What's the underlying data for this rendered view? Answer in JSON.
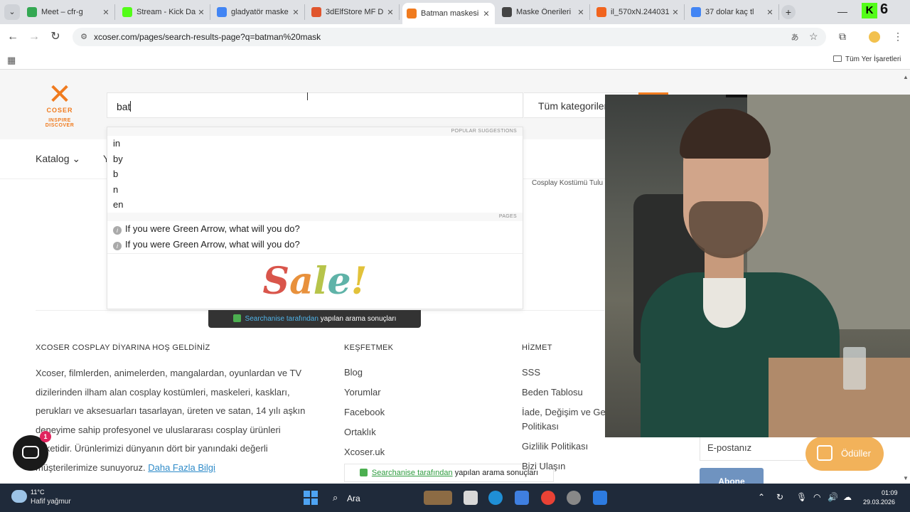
{
  "tabs": [
    {
      "title": "Meet – cfr-g",
      "favicon": "google-meet-icon",
      "color": "#34a853",
      "active": false
    },
    {
      "title": "Stream - Kick Da",
      "favicon": "kick-icon",
      "color": "#53fc18",
      "active": false
    },
    {
      "title": "gladyatör maske",
      "favicon": "google-icon",
      "color": "#4285f4",
      "active": false
    },
    {
      "title": "3dElfStore MF D",
      "favicon": "etsy-icon",
      "color": "#e0552d",
      "active": false
    },
    {
      "title": "Batman maskesi",
      "favicon": "xcoser-icon",
      "color": "#f07b1f",
      "active": true
    },
    {
      "title": "Maske Önerileri",
      "favicon": "chatgpt-icon",
      "color": "#444444",
      "active": false
    },
    {
      "title": "il_570xN.244031",
      "favicon": "etsy-e-icon",
      "color": "#f1641e",
      "active": false
    },
    {
      "title": "37 dolar kaç tl",
      "favicon": "google-icon",
      "color": "#4285f4",
      "active": false
    }
  ],
  "browser": {
    "url": "xcoser.com/pages/search-results-page?q=batman%20mask",
    "kick_count": "6",
    "bookmarks_all": "Tüm Yer İşaretleri"
  },
  "site": {
    "logo_brand": "COSER",
    "logo_tagline": "INSPIRE DISCOVER",
    "search_query": "bat",
    "category_select": "Tüm kategoriler",
    "nav_katalog": "Katalog",
    "nav_cut": "Y",
    "breadcrumb_cut": "Cosplay Kostümü Tulu"
  },
  "dropdown": {
    "popular_head": "POPULAR SUGGESTIONS",
    "suggestions": [
      "in",
      "by",
      "b",
      "n",
      "en"
    ],
    "pages_head": "PAGES",
    "pages": [
      "If you were Green Arrow, what will you do?",
      "If you were Green Arrow, what will you do?"
    ],
    "sale_text": "Sale!"
  },
  "powered_by": {
    "link": "Searchanise tarafından",
    "rest": "yapılan arama sonuçları"
  },
  "footer": {
    "col1_head": "XCOSER COSPLAY DİYARINA HOŞ GELDİNİZ",
    "about_text": "Xcoser, filmlerden, animelerden, mangalardan, oyunlardan ve TV dizilerinden ilham alan cosplay kostümleri, maskeleri, kaskları, perukları ve aksesuarları tasarlayan, üreten ve satan, 14 yılı aşkın deneyime sahip profesyonel ve uluslararası cosplay ürünleri şirketidir. Ürünlerimizi dünyanın dört bir yanındaki değerli müşterilerimize sunuyoruz.",
    "about_more": "Daha Fazla Bilgi",
    "col2_head": "KEŞFETMEK",
    "col2_links": [
      "Blog",
      "Yorumlar",
      "Facebook",
      "Ortaklık",
      "Xcoser.uk"
    ],
    "col3_head": "HİZMET",
    "col3_links": [
      "SSS",
      "Beden Tablosu",
      "İade, Değişim ve Ge",
      "Politikası",
      "Gizlilik Politikası",
      "Bizi Ulaşın"
    ],
    "email_placeholder": "E-postanız",
    "subscribe": "Abone",
    "rewards": "Ödüller",
    "chat_badge": "1"
  },
  "taskbar": {
    "temp": "11°C",
    "weather": "Hafif yağmur",
    "search": "Ara",
    "time": "01:09",
    "date": "29.03.2026"
  }
}
